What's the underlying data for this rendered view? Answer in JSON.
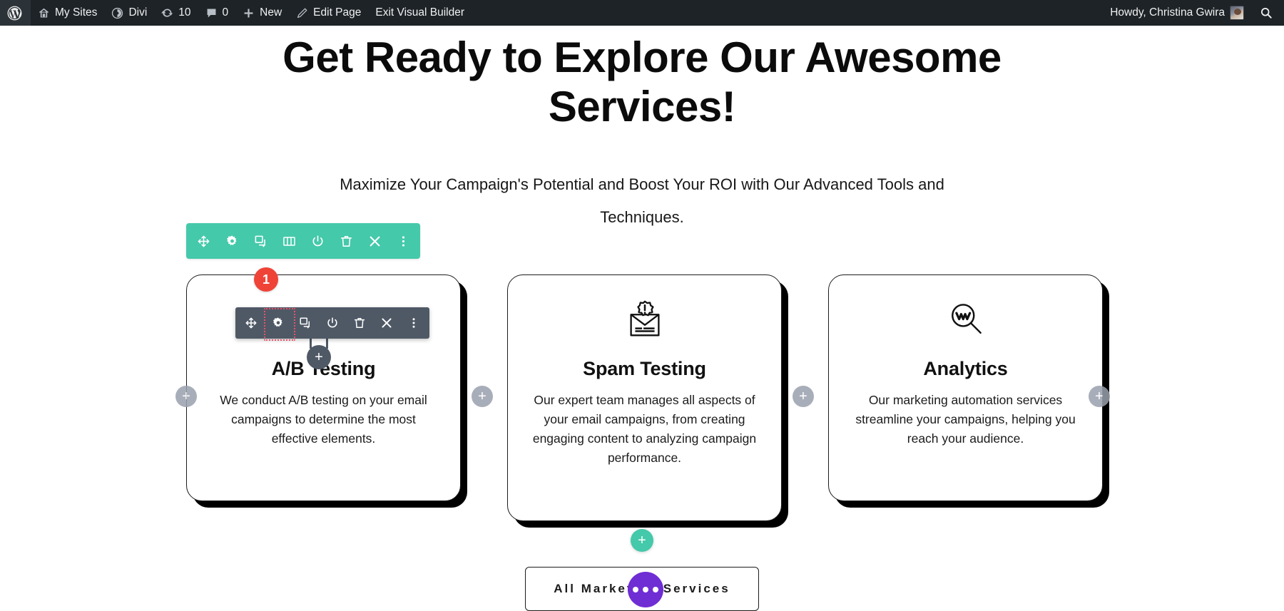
{
  "admin_bar": {
    "logo_icon": "wordpress-logo-icon",
    "items": [
      {
        "label": "My Sites",
        "icon": "sites-icon"
      },
      {
        "label": "Divi",
        "icon": "divi-icon"
      },
      {
        "label": "10",
        "icon": "updates-icon"
      },
      {
        "label": "0",
        "icon": "comments-icon"
      },
      {
        "label": "New",
        "icon": "plus-icon"
      },
      {
        "label": "Edit Page",
        "icon": "pencil-icon"
      },
      {
        "label": "Exit Visual Builder",
        "icon": ""
      }
    ],
    "account": {
      "greeting": "Howdy, Christina Gwira",
      "avatar_icon": "user-avatar",
      "search_icon": "search-icon"
    },
    "background_color": "#1d2327",
    "text_color": "#f0f0f1"
  },
  "page": {
    "heading": "Get Ready to Explore Our Awesome Services!",
    "subheading": "Maximize Your Campaign's Potential and Boost Your ROI with Our Advanced Tools and Techniques."
  },
  "section_toolbar": {
    "background_color": "#44c9aa",
    "buttons": [
      {
        "name": "move-section",
        "icon": "move-arrows-icon"
      },
      {
        "name": "section-settings",
        "icon": "gear-icon"
      },
      {
        "name": "duplicate-section",
        "icon": "duplicate-icon"
      },
      {
        "name": "column-structure",
        "icon": "columns-icon"
      },
      {
        "name": "disable-section",
        "icon": "power-icon"
      },
      {
        "name": "delete-section",
        "icon": "trash-icon"
      },
      {
        "name": "close-section",
        "icon": "close-x-icon"
      },
      {
        "name": "section-more",
        "icon": "vertical-dots-icon"
      }
    ]
  },
  "module_toolbar": {
    "background_color": "#4f5966",
    "highlighted_button": "module-settings",
    "highlight_color": "#e8526a",
    "step_badge": "1",
    "step_badge_color": "#ef4338",
    "buttons": [
      {
        "name": "move-module",
        "icon": "move-arrows-icon"
      },
      {
        "name": "module-settings",
        "icon": "gear-icon"
      },
      {
        "name": "duplicate-module",
        "icon": "duplicate-icon"
      },
      {
        "name": "disable-module",
        "icon": "power-icon"
      },
      {
        "name": "delete-module",
        "icon": "trash-icon"
      },
      {
        "name": "close-module",
        "icon": "close-x-icon"
      },
      {
        "name": "module-more",
        "icon": "vertical-dots-icon"
      }
    ],
    "add_module_icon": "plus-icon"
  },
  "cards": [
    {
      "icon": "none",
      "title": "A/B Testing",
      "body": "We conduct A/B testing on your email campaigns to determine the most effective elements."
    },
    {
      "icon": "envelope-alert-icon",
      "title": "Spam Testing",
      "body": "Our expert team manages all aspects of your email campaigns, from creating engaging content to analyzing campaign performance."
    },
    {
      "icon": "magnifier-chart-icon",
      "title": "Analytics",
      "body": "Our marketing automation services streamline your campaigns, helping you reach your audience."
    }
  ],
  "column_add_buttons": {
    "icon": "plus-icon",
    "color": "#9aa1ad",
    "count": 4
  },
  "row_add_button": {
    "icon": "plus-icon",
    "color": "#44c9aa"
  },
  "cta": {
    "label": "All Marketing Services",
    "spinner": {
      "name": "loading-spinner",
      "color": "#6f2dd4",
      "dots": 3
    }
  }
}
